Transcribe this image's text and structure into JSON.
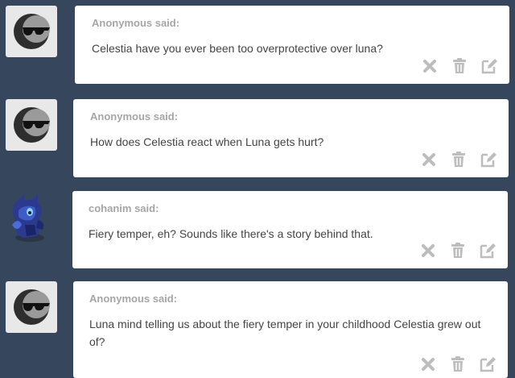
{
  "colors": {
    "background": "#36465d",
    "card": "#ffffff",
    "asker_text": "#a6a6a6",
    "question_text": "#444444",
    "action_icons": "#bdbdbd"
  },
  "icons": {
    "anonymous_avatar": "crescent-moon-with-sunglasses-icon",
    "user_avatar": "blue-pony-character-avatar",
    "delete": "x-delete-icon",
    "trash": "trash-can-icon",
    "edit": "pencil-edit-icon"
  },
  "posts": [
    {
      "avatar": "anonymous",
      "asker": "Anonymous said:",
      "question": "Celestia have you ever been too overprotective over luna?"
    },
    {
      "avatar": "anonymous",
      "asker": "Anonymous said:",
      "question": "How does Celestia react when Luna gets hurt?"
    },
    {
      "avatar": "cohanim",
      "asker": "cohanim said:",
      "question": "Fiery temper, eh? Sounds like there's a story behind that."
    },
    {
      "avatar": "anonymous",
      "asker": "Anonymous said:",
      "question": "Luna mind telling us about the fiery temper in your childhood Celestia grew out of?"
    }
  ]
}
